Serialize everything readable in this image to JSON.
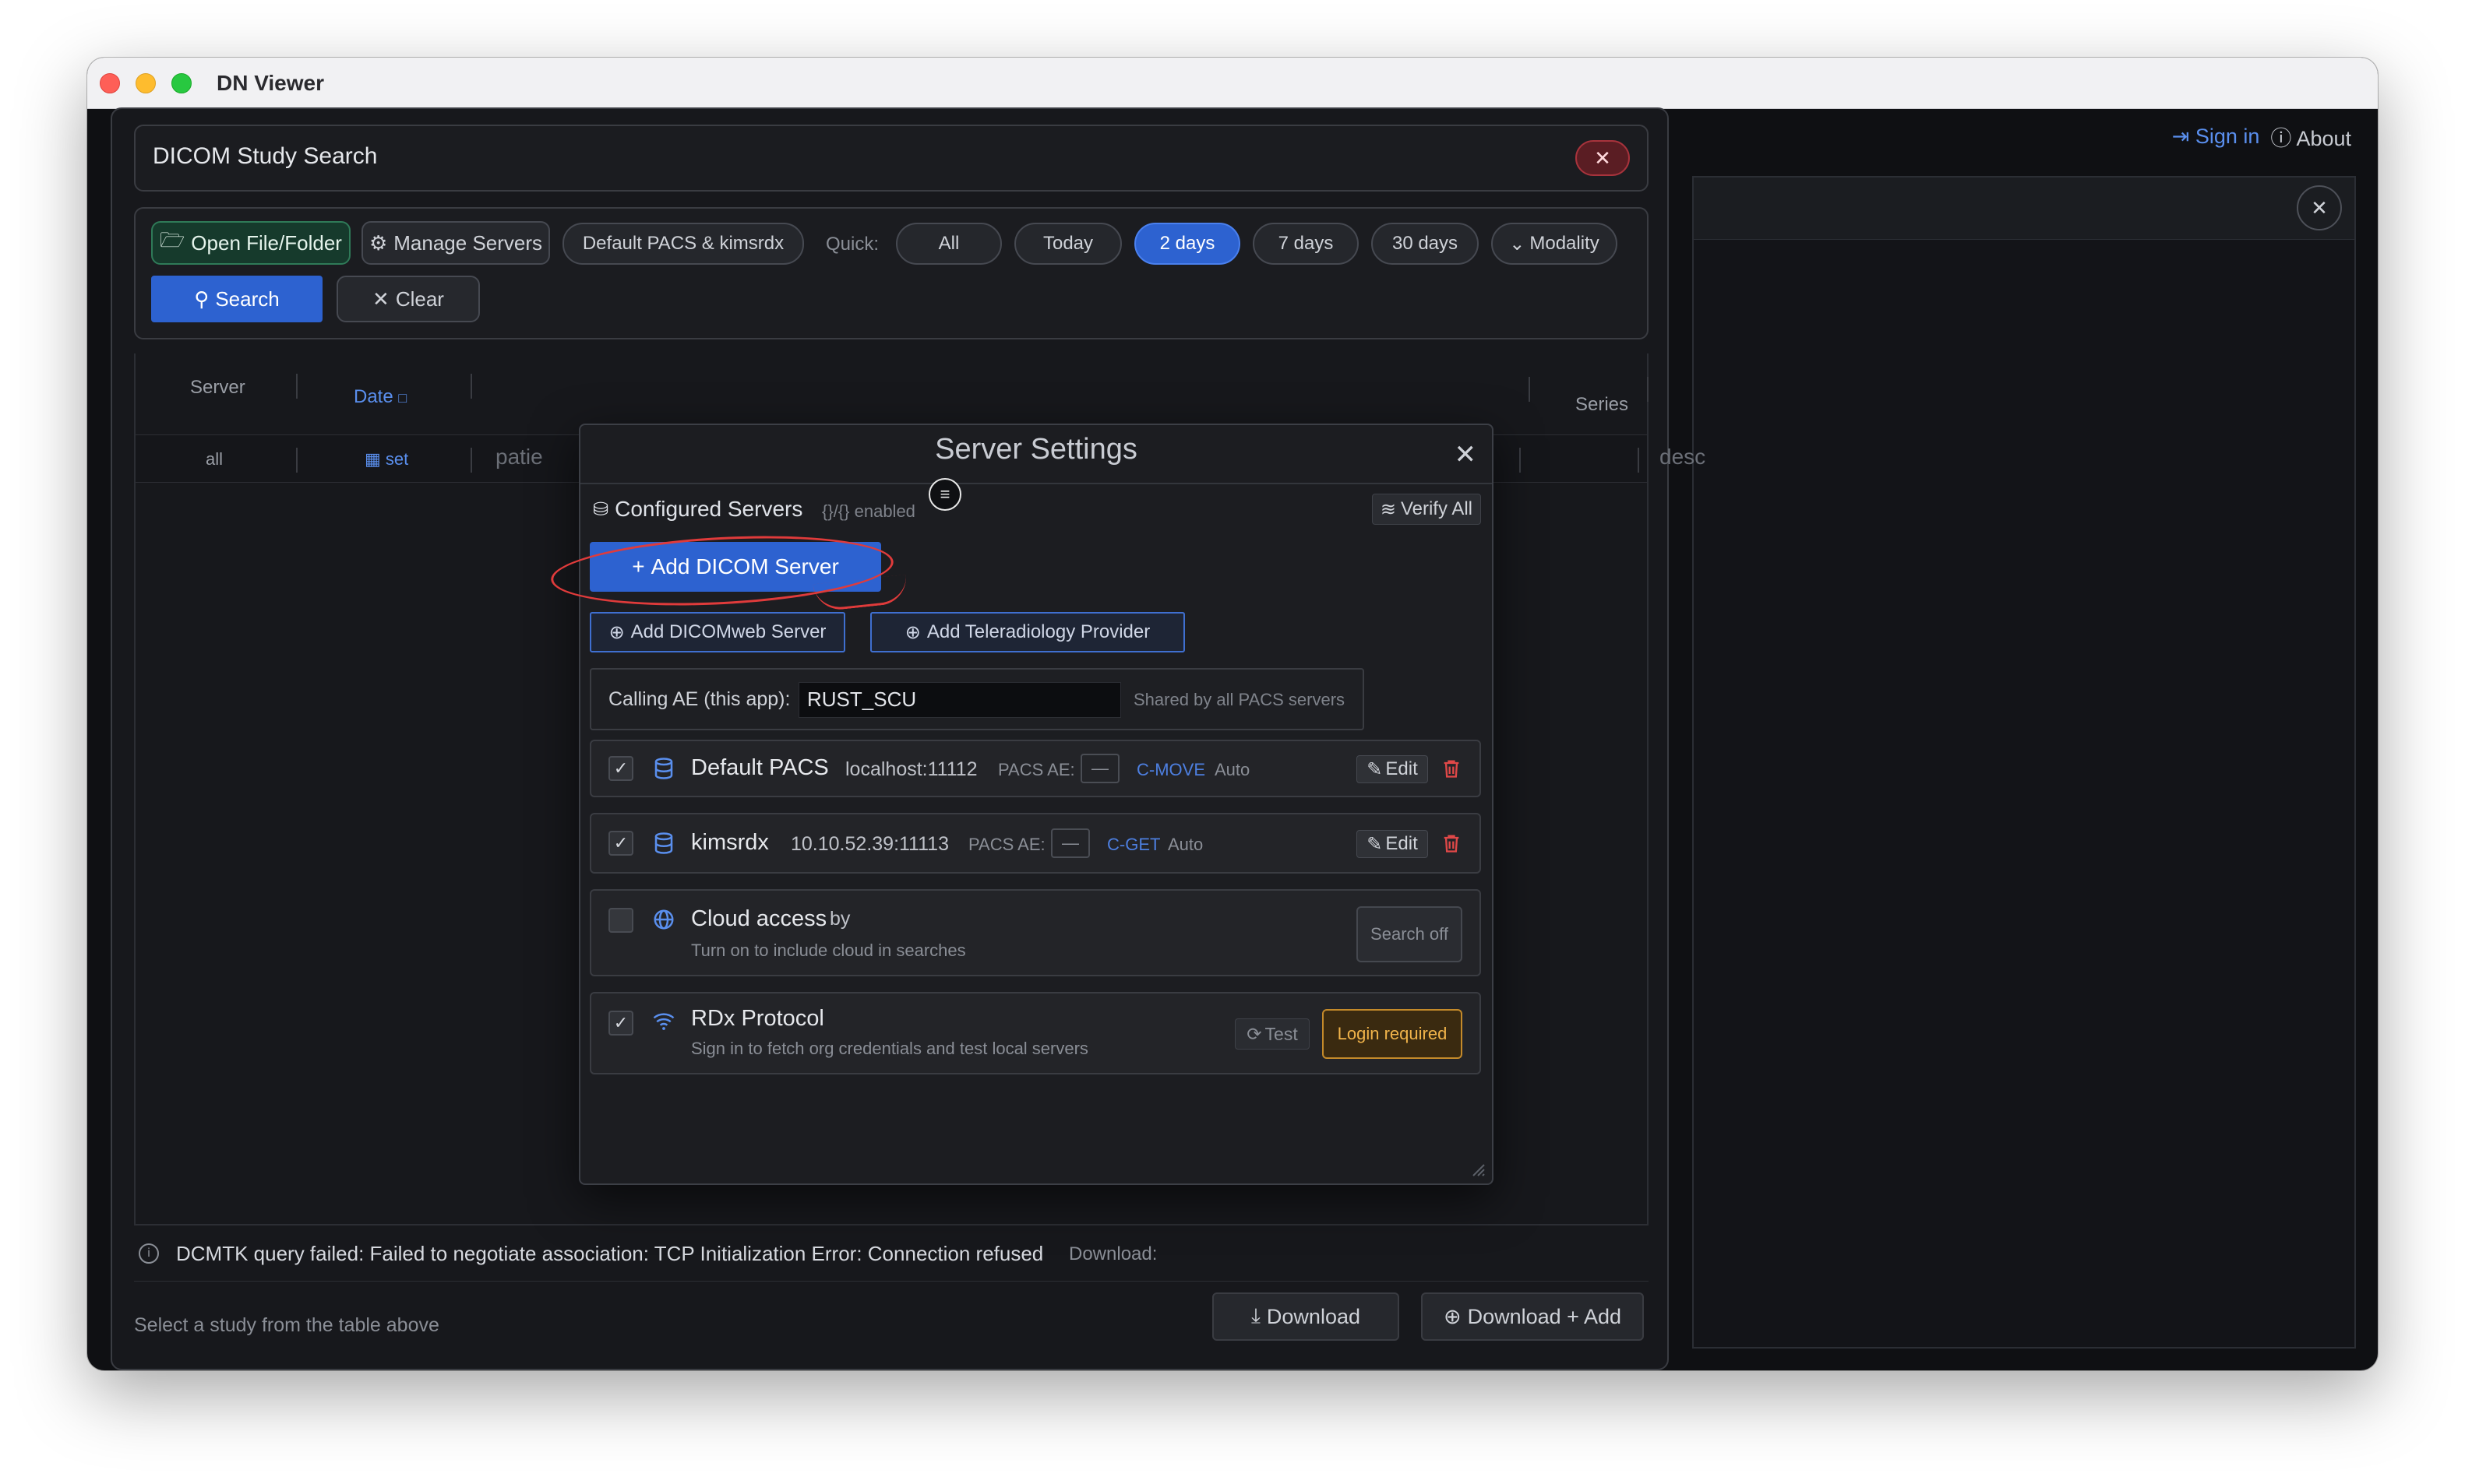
{
  "window": {
    "title": "DN Viewer"
  },
  "top_right": {
    "signin": "Sign in",
    "about": "About"
  },
  "dialog": {
    "title": "DICOM Study Search",
    "toolbar": {
      "open": "Open File/Folder",
      "manage": "Manage Servers",
      "servers_selected": "Default PACS & kimsrdx",
      "quick_label": "Quick:",
      "quick": [
        "All",
        "Today",
        "2 days",
        "7 days",
        "30 days"
      ],
      "quick_active": "2 days",
      "modality": "Modality",
      "search": "Search",
      "clear": "Clear"
    },
    "table": {
      "headers": {
        "server": "Server",
        "date": "Date",
        "series": "Series"
      },
      "filters": {
        "server": "all",
        "date": "set",
        "patient": "patie",
        "desc": "desc"
      }
    },
    "status": {
      "message": "DCMTK query failed: Failed to negotiate association: TCP Initialization Error: Connection refused",
      "download_label": "Download:"
    },
    "footer": {
      "hint": "Select a study from the table above",
      "download": "Download",
      "download_add": "Download + Add"
    }
  },
  "server_settings": {
    "title": "Server Settings",
    "configured_title": "Configured Servers",
    "configured_sub": "{}/{} enabled",
    "verify_all": "Verify All",
    "add_dicom": "Add DICOM Server",
    "add_dicomweb": "Add DICOMweb Server",
    "add_tele": "Add Teleradiology Provider",
    "calling_label": "Calling AE (this app):",
    "calling_value": "RUST_SCU",
    "calling_hint": "Shared by all PACS servers",
    "pacs_ae_label": "PACS AE:",
    "ae_placeholder": "—",
    "edit": "Edit",
    "servers": [
      {
        "name": "Default PACS",
        "address": "localhost:11112",
        "protocol": "C-MOVE",
        "mode": "Auto",
        "enabled": true
      },
      {
        "name": "kimsrdx",
        "address": "10.10.52.39:11113",
        "protocol": "C-GET",
        "mode": "Auto",
        "enabled": true
      }
    ],
    "cloud": {
      "name": "Cloud access",
      "by": "by",
      "sub": "Turn on to include cloud in searches",
      "button": "Search off",
      "enabled": false
    },
    "rdx": {
      "name": "RDx Protocol",
      "sub": "Sign in to fetch org credentials and test local servers",
      "test": "Test",
      "login": "Login required",
      "enabled": true
    }
  },
  "colors": {
    "accent": "#2d62d0",
    "annotation": "#e03b3b",
    "warning": "#f0b34a",
    "danger": "#e04848"
  }
}
